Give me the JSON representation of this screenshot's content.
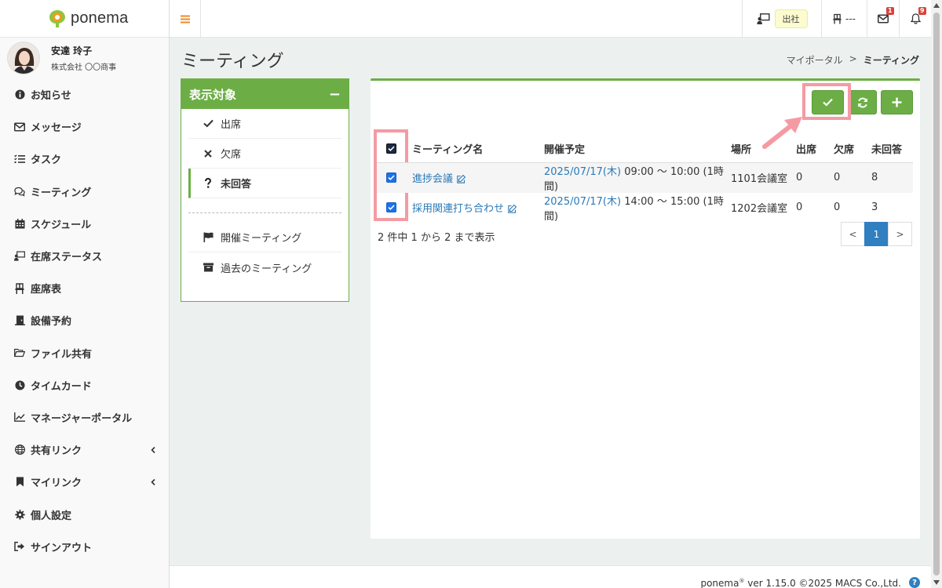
{
  "brand": {
    "name": "ponema"
  },
  "user": {
    "name": "安達 玲子",
    "company": "株式会社 〇〇商事"
  },
  "nav": [
    {
      "label": "お知らせ",
      "icon": "info-circle-icon"
    },
    {
      "label": "メッセージ",
      "icon": "envelope-icon"
    },
    {
      "label": "タスク",
      "icon": "tasks-icon"
    },
    {
      "label": "ミーティング",
      "icon": "comments-icon"
    },
    {
      "label": "スケジュール",
      "icon": "calendar-icon"
    },
    {
      "label": "在席ステータス",
      "icon": "desk-status-icon"
    },
    {
      "label": "座席表",
      "icon": "chair-icon"
    },
    {
      "label": "設備予約",
      "icon": "door-icon"
    },
    {
      "label": "ファイル共有",
      "icon": "folder-open-icon"
    },
    {
      "label": "タイムカード",
      "icon": "clock-icon"
    },
    {
      "label": "マネージャーポータル",
      "icon": "line-chart-icon"
    },
    {
      "label": "共有リンク",
      "icon": "globe-icon",
      "has_children": true
    },
    {
      "label": "マイリンク",
      "icon": "bookmark-icon",
      "has_children": true
    },
    {
      "label": "個人設定",
      "icon": "gear-icon"
    },
    {
      "label": "サインアウト",
      "icon": "sign-out-icon"
    }
  ],
  "topbar": {
    "status_label": "出社",
    "seat_label": "---",
    "message_count": "1",
    "notification_count": "9"
  },
  "page": {
    "title": "ミーティング",
    "breadcrumb": {
      "parent": "マイポータル",
      "separator": ">",
      "current": "ミーティング"
    }
  },
  "filter": {
    "title": "表示対象",
    "collapse_symbol": "−",
    "items": [
      {
        "label": "出席",
        "icon": "check-icon"
      },
      {
        "label": "欠席",
        "icon": "times-icon"
      },
      {
        "label": "未回答",
        "icon": "question-icon",
        "active": true
      }
    ],
    "extra_items": [
      {
        "label": "開催ミーティング",
        "icon": "flag-icon"
      },
      {
        "label": "過去のミーティング",
        "icon": "archive-icon"
      }
    ]
  },
  "table": {
    "headers": [
      "ミーティング名",
      "開催予定",
      "場所",
      "出席",
      "欠席",
      "未回答"
    ],
    "rows": [
      {
        "name": "進捗会議",
        "date": "2025/07/17(木)",
        "time": "09:00 〜 10:00 (1時間)",
        "place": "1101会議室",
        "attend": "0",
        "absent": "0",
        "unanswered": "8",
        "checked": true
      },
      {
        "name": "採用関連打ち合わせ",
        "date": "2025/07/17(木)",
        "time": "14:00 〜 15:00 (1時間)",
        "place": "1202会議室",
        "attend": "0",
        "absent": "0",
        "unanswered": "3",
        "checked": true
      }
    ]
  },
  "summary": "2 件中 1 から 2 まで表示",
  "pager": {
    "prev": "<",
    "current": "1",
    "next": ">"
  },
  "footer": {
    "brand": "ponema",
    "reg": "®",
    "text": "ver 1.15.0 ©2025 MACS Co.,Ltd.",
    "help": "?"
  },
  "colors": {
    "accent": "#6cae45",
    "link": "#2a7ab8",
    "highlight": "#f59aa3",
    "badge": "#d9433b"
  }
}
